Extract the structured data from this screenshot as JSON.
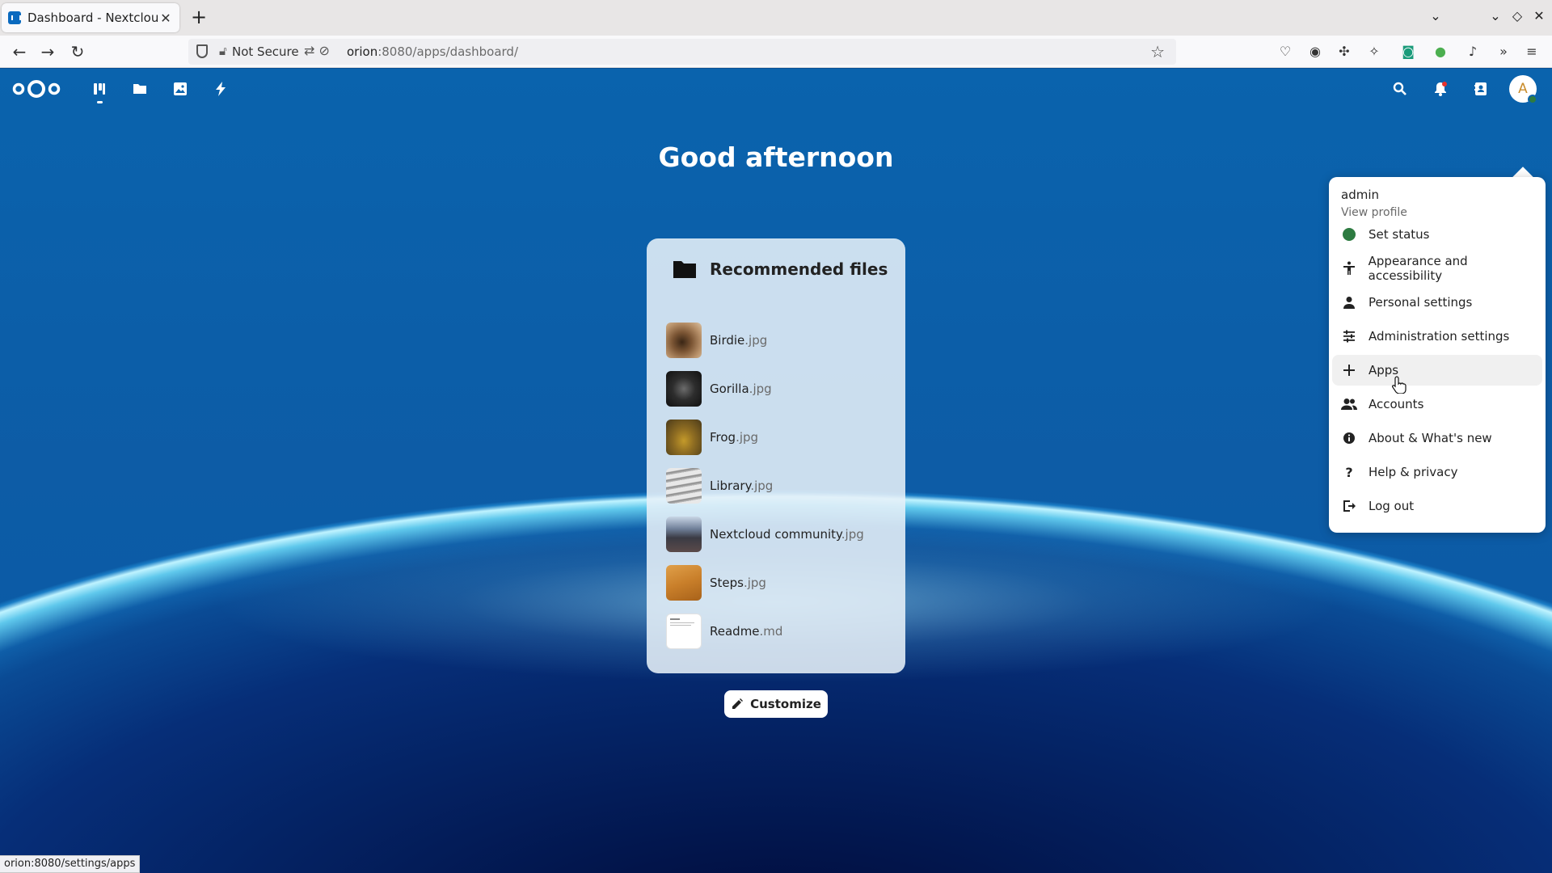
{
  "browser": {
    "tab_title": "Dashboard - Nextcloud",
    "tab_close": "✕",
    "new_tab": "+",
    "not_secure": "Not Secure",
    "url_host": "orion",
    "url_rest": ":8080/apps/dashboard/",
    "status_url": "orion:8080/settings/apps"
  },
  "header": {
    "apps": [
      "Dashboard",
      "Files",
      "Photos",
      "Activity"
    ],
    "avatar_initial": "A"
  },
  "greeting": "Good afternoon",
  "widget": {
    "title": "Recommended files",
    "files": [
      {
        "base": "Birdie",
        "ext": ".jpg"
      },
      {
        "base": "Gorilla",
        "ext": ".jpg"
      },
      {
        "base": "Frog",
        "ext": ".jpg"
      },
      {
        "base": "Library",
        "ext": ".jpg"
      },
      {
        "base": "Nextcloud community",
        "ext": ".jpg"
      },
      {
        "base": "Steps",
        "ext": ".jpg"
      },
      {
        "base": "Readme",
        "ext": ".md"
      }
    ]
  },
  "customize_label": "Customize",
  "user_menu": {
    "name": "admin",
    "view_profile": "View profile",
    "items": [
      {
        "label": "Set status",
        "icon": "status-online-icon"
      },
      {
        "label": "Appearance and accessibility",
        "icon": "accessibility-icon"
      },
      {
        "label": "Personal settings",
        "icon": "person-icon"
      },
      {
        "label": "Administration settings",
        "icon": "tune-icon"
      },
      {
        "label": "Apps",
        "icon": "plus-icon"
      },
      {
        "label": "Accounts",
        "icon": "accounts-icon"
      },
      {
        "label": "About & What's new",
        "icon": "info-icon"
      },
      {
        "label": "Help & privacy",
        "icon": "help-icon"
      },
      {
        "label": "Log out",
        "icon": "logout-icon"
      }
    ]
  },
  "colors": {
    "brand_blue": "#0a63ad",
    "status_online": "#2d7b41"
  }
}
